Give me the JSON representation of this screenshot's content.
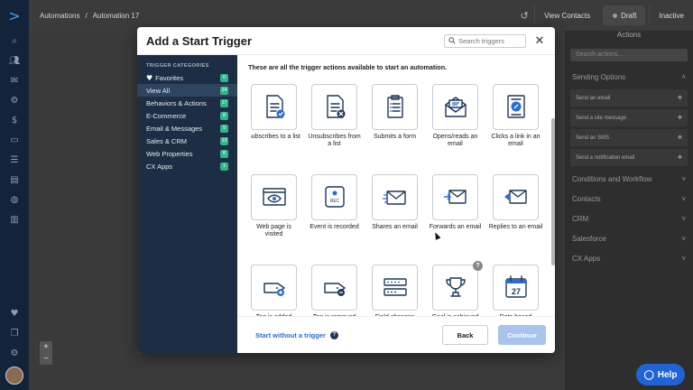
{
  "breadcrumb": {
    "root": "Automations",
    "separator": "/",
    "current": "Automation 17"
  },
  "header": {
    "view_contacts": "View Contacts",
    "draft": "Draft",
    "inactive": "Inactive"
  },
  "actions_panel": {
    "title": "Actions",
    "search_placeholder": "Search actions...",
    "groups": {
      "sending": "Sending Options",
      "conditions": "Conditions and Workflow",
      "contacts": "Contacts",
      "crm": "CRM",
      "salesforce": "Salesforce",
      "cx_apps": "CX Apps"
    },
    "items": [
      {
        "label": "Send an email"
      },
      {
        "label": "Send a site message"
      },
      {
        "label": "Send an SMS"
      },
      {
        "label": "Send a notification email"
      }
    ]
  },
  "help": {
    "label": "Help"
  },
  "zoom": {
    "in": "+",
    "out": "−"
  },
  "modal": {
    "title": "Add a Start Trigger",
    "search_placeholder": "Search triggers",
    "intro": "These are all the trigger actions available to start an automation.",
    "categories_heading": "TRIGGER CATEGORIES",
    "categories": [
      {
        "label": "Favorites",
        "count": "0"
      },
      {
        "label": "View All",
        "count": "24"
      },
      {
        "label": "Behaviors & Actions",
        "count": "17"
      },
      {
        "label": "E-Commerce",
        "count": "8"
      },
      {
        "label": "Email & Messages",
        "count": "9"
      },
      {
        "label": "Sales & CRM",
        "count": "13"
      },
      {
        "label": "Web Properties",
        "count": "8"
      },
      {
        "label": "CX Apps",
        "count": "1"
      }
    ],
    "triggers": [
      {
        "label": "Subscribes to a list",
        "icon": "subscribe-list-icon"
      },
      {
        "label": "Unsubscribes from a list",
        "icon": "unsubscribe-list-icon"
      },
      {
        "label": "Submits a form",
        "icon": "form-icon"
      },
      {
        "label": "Opens/reads an email",
        "icon": "open-email-icon"
      },
      {
        "label": "Clicks a link in an email",
        "icon": "click-link-icon"
      },
      {
        "label": "Web page is visited",
        "icon": "browser-eye-icon"
      },
      {
        "label": "Event is recorded",
        "icon": "rec-event-icon"
      },
      {
        "label": "Shares an email",
        "icon": "share-email-icon"
      },
      {
        "label": "Forwards an email",
        "icon": "forward-email-icon"
      },
      {
        "label": "Replies to an email",
        "icon": "reply-email-icon"
      },
      {
        "label": "Tag is added",
        "icon": "tag-add-icon"
      },
      {
        "label": "Tag is removed",
        "icon": "tag-remove-icon"
      },
      {
        "label": "Field changes",
        "icon": "field-change-icon"
      },
      {
        "label": "Goal is achieved",
        "icon": "trophy-icon"
      },
      {
        "label": "Date based",
        "icon": "calendar-icon"
      },
      {
        "label": "",
        "icon": ""
      },
      {
        "label": "",
        "icon": ""
      },
      {
        "label": "",
        "icon": ""
      },
      {
        "label": "",
        "icon": ""
      },
      {
        "label": "",
        "icon": ""
      }
    ],
    "calendar_day": "27",
    "rec_label": "REC",
    "help_mark": "?",
    "start_without": "Start without a trigger",
    "back": "Back",
    "continue": "Continue"
  },
  "colors": {
    "brand_blue": "#2a6bd8",
    "nav_dark": "#1d2e44",
    "badge_green": "#30b58c",
    "help_blue": "#1f63d6"
  }
}
